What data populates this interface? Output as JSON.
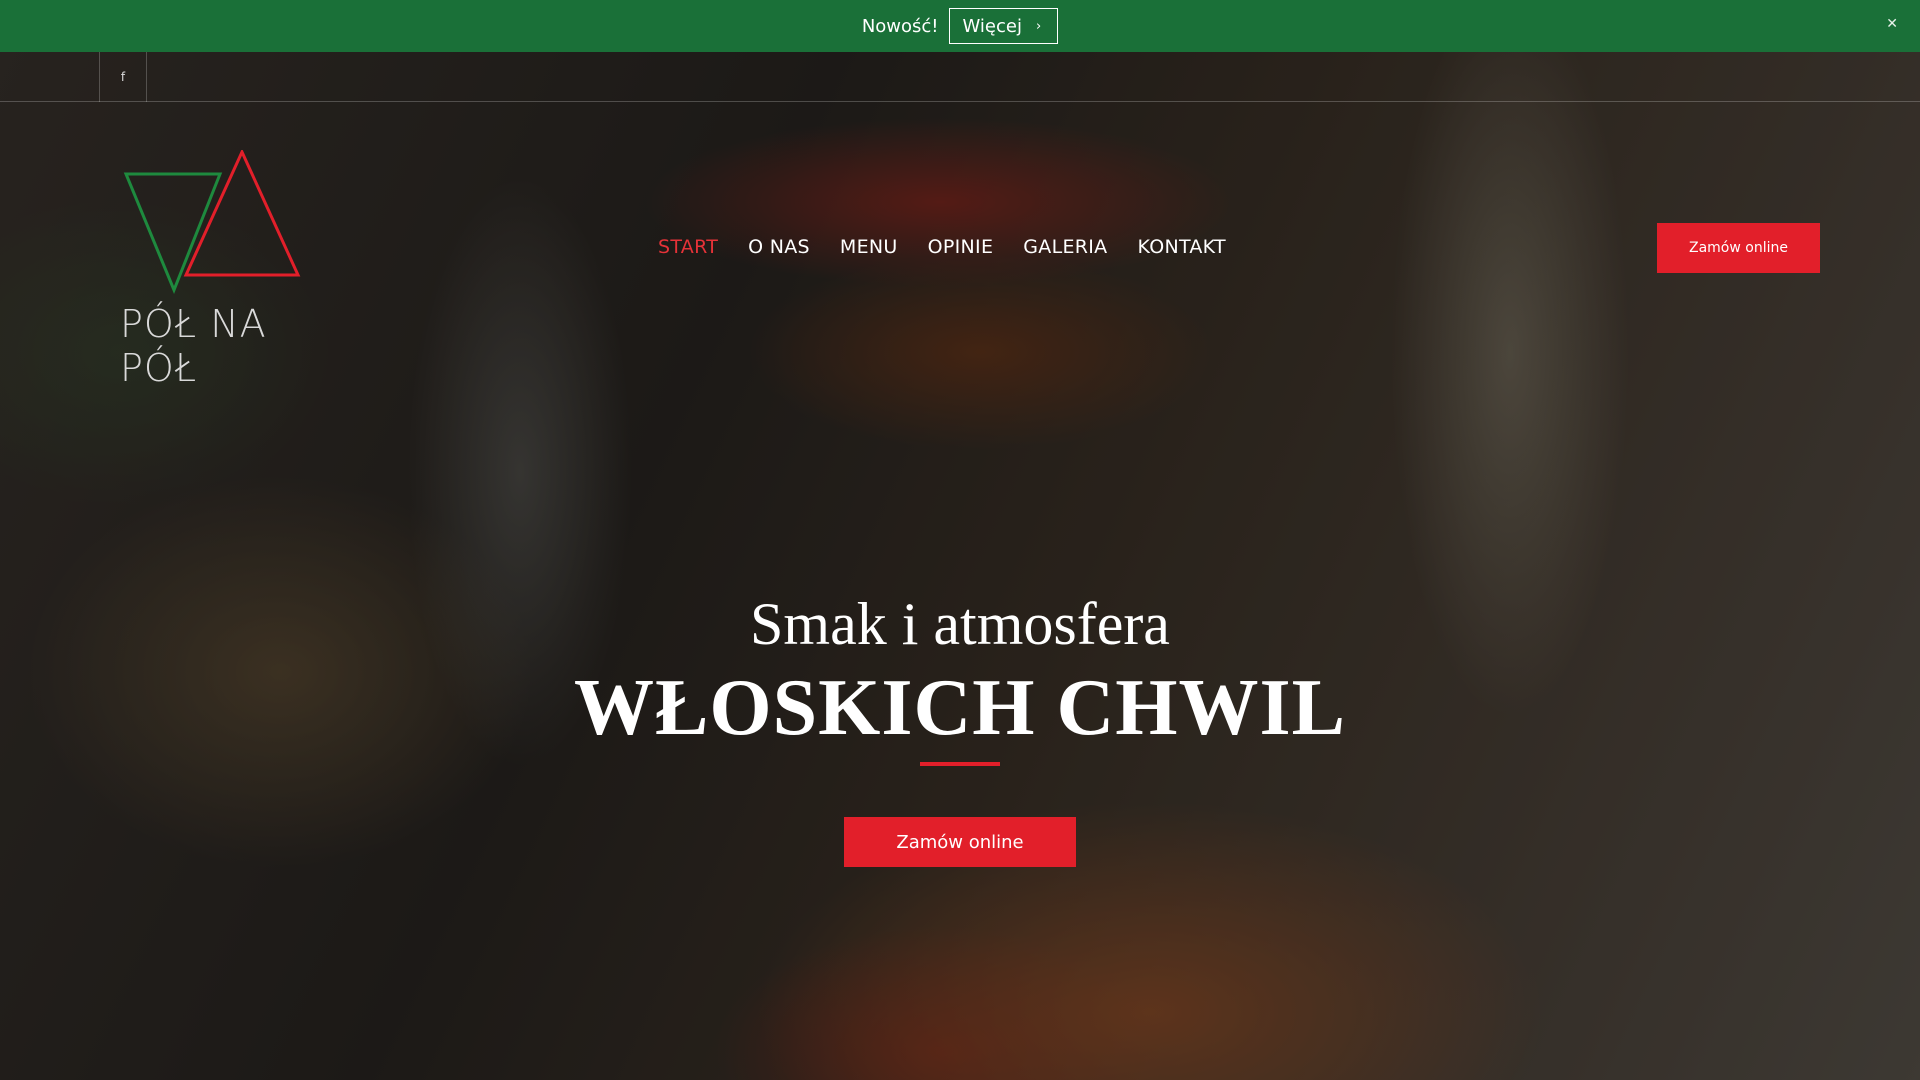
{
  "announcement": {
    "text": "Nowość!",
    "button_label": "Więcej",
    "button_icon": "chevron-right-icon",
    "close_icon": "close-icon"
  },
  "utility": {
    "icon": "facebook-icon",
    "glyph": "f"
  },
  "logo": {
    "text": "PÓŁ NA PÓŁ",
    "colors": {
      "green": "#1e8a3e",
      "red": "#e21f2a"
    }
  },
  "nav": {
    "items": [
      {
        "label": "START",
        "active": true
      },
      {
        "label": "O NAS"
      },
      {
        "label": "MENU"
      },
      {
        "label": "OPINIE"
      },
      {
        "label": "GALERIA"
      },
      {
        "label": "KONTAKT"
      }
    ]
  },
  "header": {
    "order_label": "Zamów online"
  },
  "hero": {
    "subtitle": "Smak i atmosfera",
    "title": "WŁOSKICH CHWIL",
    "order_label": "Zamów online"
  },
  "theme": {
    "accent": "#e21f2a",
    "topbar": "#1a7038"
  }
}
